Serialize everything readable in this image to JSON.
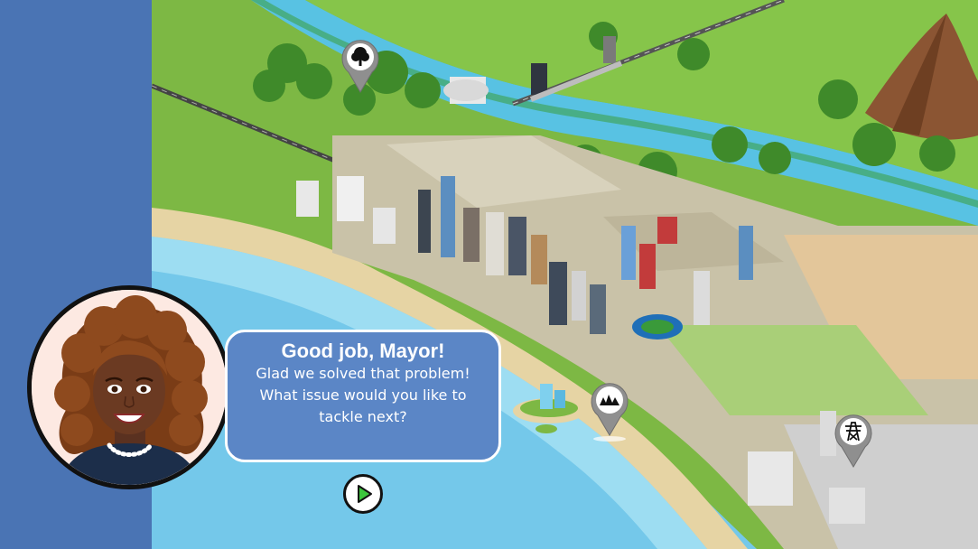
{
  "dialog": {
    "title": "Good job, Mayor!",
    "message": "Glad we solved that problem!\nWhat issue would you like to\ntackle next?"
  },
  "advisor": {
    "icon": "advisor-portrait"
  },
  "next_button": {
    "icon": "play-arrow-icon"
  },
  "map_pins": [
    {
      "icon": "tree-icon",
      "topic": "parks"
    },
    {
      "icon": "wave-icon",
      "topic": "coast"
    },
    {
      "icon": "power-tower-icon",
      "topic": "energy"
    }
  ],
  "colors": {
    "panel": "#4a74b4",
    "bubble": "#5b86c6",
    "ocean": "#7fd0ee",
    "river": "#59c4e4",
    "grass": "#7db844",
    "sand": "#e2cfa0",
    "pin": "#8f8f8f",
    "play": "#3cc63c"
  }
}
